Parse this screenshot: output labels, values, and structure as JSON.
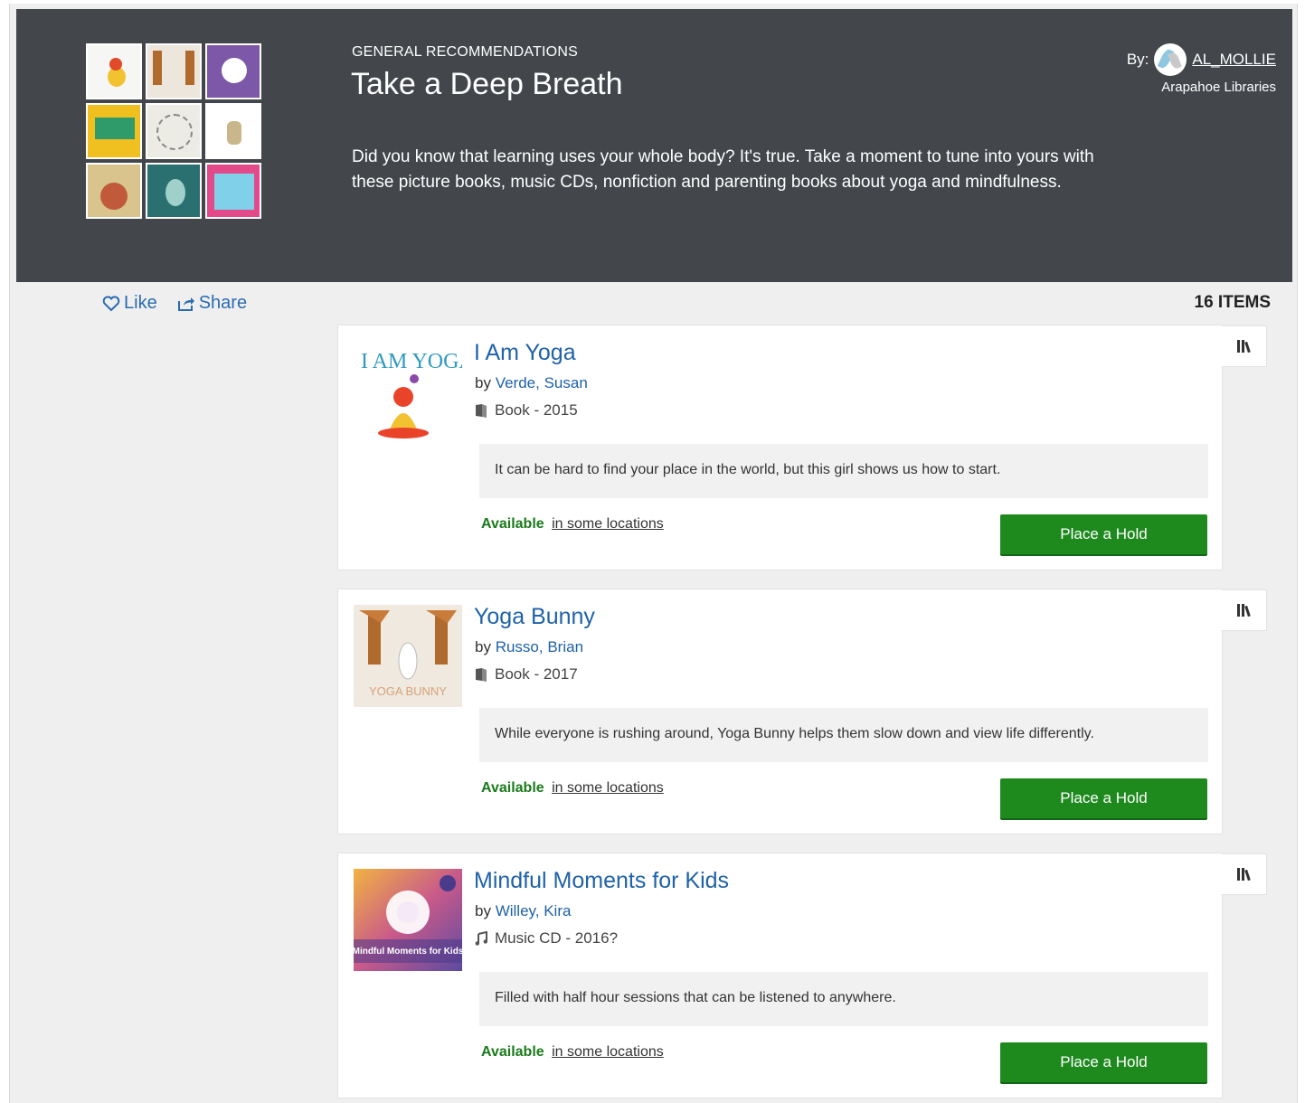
{
  "hero": {
    "eyebrow": "GENERAL RECOMMENDATIONS",
    "title": "Take a Deep Breath",
    "description": "Did you know that learning uses your whole body? It's true. Take a moment to tune into yours with these picture books, music CDs, nonfiction and parenting books about yoga and mindfulness.",
    "by_label": "By:",
    "author": "AL_MOLLIE",
    "organization": "Arapahoe Libraries",
    "collage_colors": [
      "#f5f5f5",
      "#ece6dc",
      "#7d58a8",
      "#f0c020",
      "#ecebe4",
      "#ffffff",
      "#d8c48c",
      "#2a7070",
      "#e24a8a"
    ]
  },
  "actions": {
    "like": "Like",
    "share": "Share"
  },
  "item_count": "16 ITEMS",
  "items": [
    {
      "title": "I Am Yoga",
      "by": "by",
      "author": "Verde, Susan",
      "format_icon": "book-icon",
      "format": "Book - 2015",
      "note": "It can be hard to find your place in the world, but this girl shows us how to start.",
      "available": "Available",
      "locations": "in some locations",
      "hold": "Place a Hold",
      "cover_text": "I AM YOGA"
    },
    {
      "title": "Yoga Bunny",
      "by": "by",
      "author": "Russo, Brian",
      "format_icon": "book-icon",
      "format": "Book - 2017",
      "note": "While everyone is rushing around, Yoga Bunny helps them slow down and view life differently.",
      "available": "Available",
      "locations": "in some locations",
      "hold": "Place a Hold",
      "cover_text": "YOGA BUNNY"
    },
    {
      "title": "Mindful Moments for Kids",
      "by": "by",
      "author": "Willey, Kira",
      "format_icon": "music-note-icon",
      "format": "Music CD - 2016?",
      "note": "Filled with half hour sessions that can be listened to anywhere.",
      "available": "Available",
      "locations": "in some locations",
      "hold": "Place a Hold",
      "cover_text": "Mindful Moments for Kids"
    }
  ]
}
